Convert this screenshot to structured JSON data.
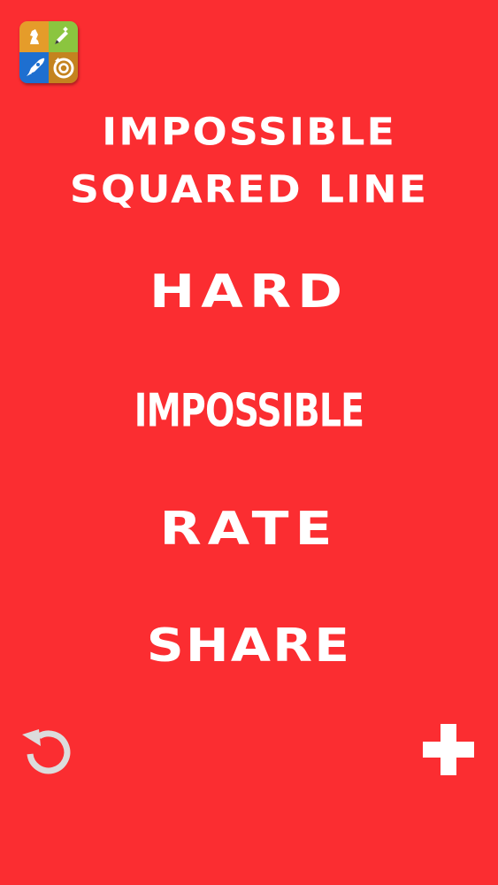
{
  "app": {
    "icon_name": "game-collection-app-icon",
    "quadrant_icons": [
      "chess-knight-icon",
      "pencil-icon",
      "rocket-icon",
      "target-timer-icon"
    ]
  },
  "title": {
    "line1": "IMPOSSIBLE",
    "line2": "SQUARED LINE"
  },
  "menu": {
    "hard_label": "HARD",
    "impossible_label": "IMPOSSIBLE",
    "rate_label": "RATE",
    "share_label": "SHARE"
  },
  "controls": {
    "restart_icon": "restart-icon",
    "add_icon": "plus-icon"
  },
  "colors": {
    "background": "#fb2d31",
    "text": "#ffffff",
    "icon_orange": "#e59c2a",
    "icon_green": "#8bc53f",
    "icon_blue": "#1e6fd0",
    "icon_brown": "#c4831f"
  }
}
